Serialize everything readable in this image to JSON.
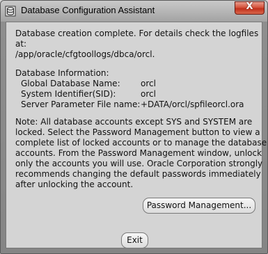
{
  "window": {
    "title": "Database Configuration Assistant",
    "close_label": "X",
    "icon": "database-icon"
  },
  "message": {
    "line1": "Database creation complete. For details check the logfiles",
    "line2": "at:",
    "line3": " /app/oracle/cfgtoollogs/dbca/orcl."
  },
  "info": {
    "heading": "Database Information:",
    "rows": [
      {
        "label": "Global Database Name:",
        "value": "orcl"
      },
      {
        "label": "System Identifier(SID):",
        "value": "orcl"
      },
      {
        "label": "Server Parameter File name:",
        "value": "+DATA/orcl/spfileorcl.ora"
      }
    ]
  },
  "note": {
    "lines": [
      "Note: All database accounts except SYS and SYSTEM are",
      "locked. Select the Password Management button to view a",
      "complete list of locked accounts or to manage the database",
      "accounts. From the Password Management window, unlock",
      "only the accounts you will use. Oracle Corporation strongly",
      "recommends changing the default passwords immediately",
      "after unlocking the account."
    ]
  },
  "buttons": {
    "password_management": "Password Management...",
    "exit": "Exit"
  }
}
